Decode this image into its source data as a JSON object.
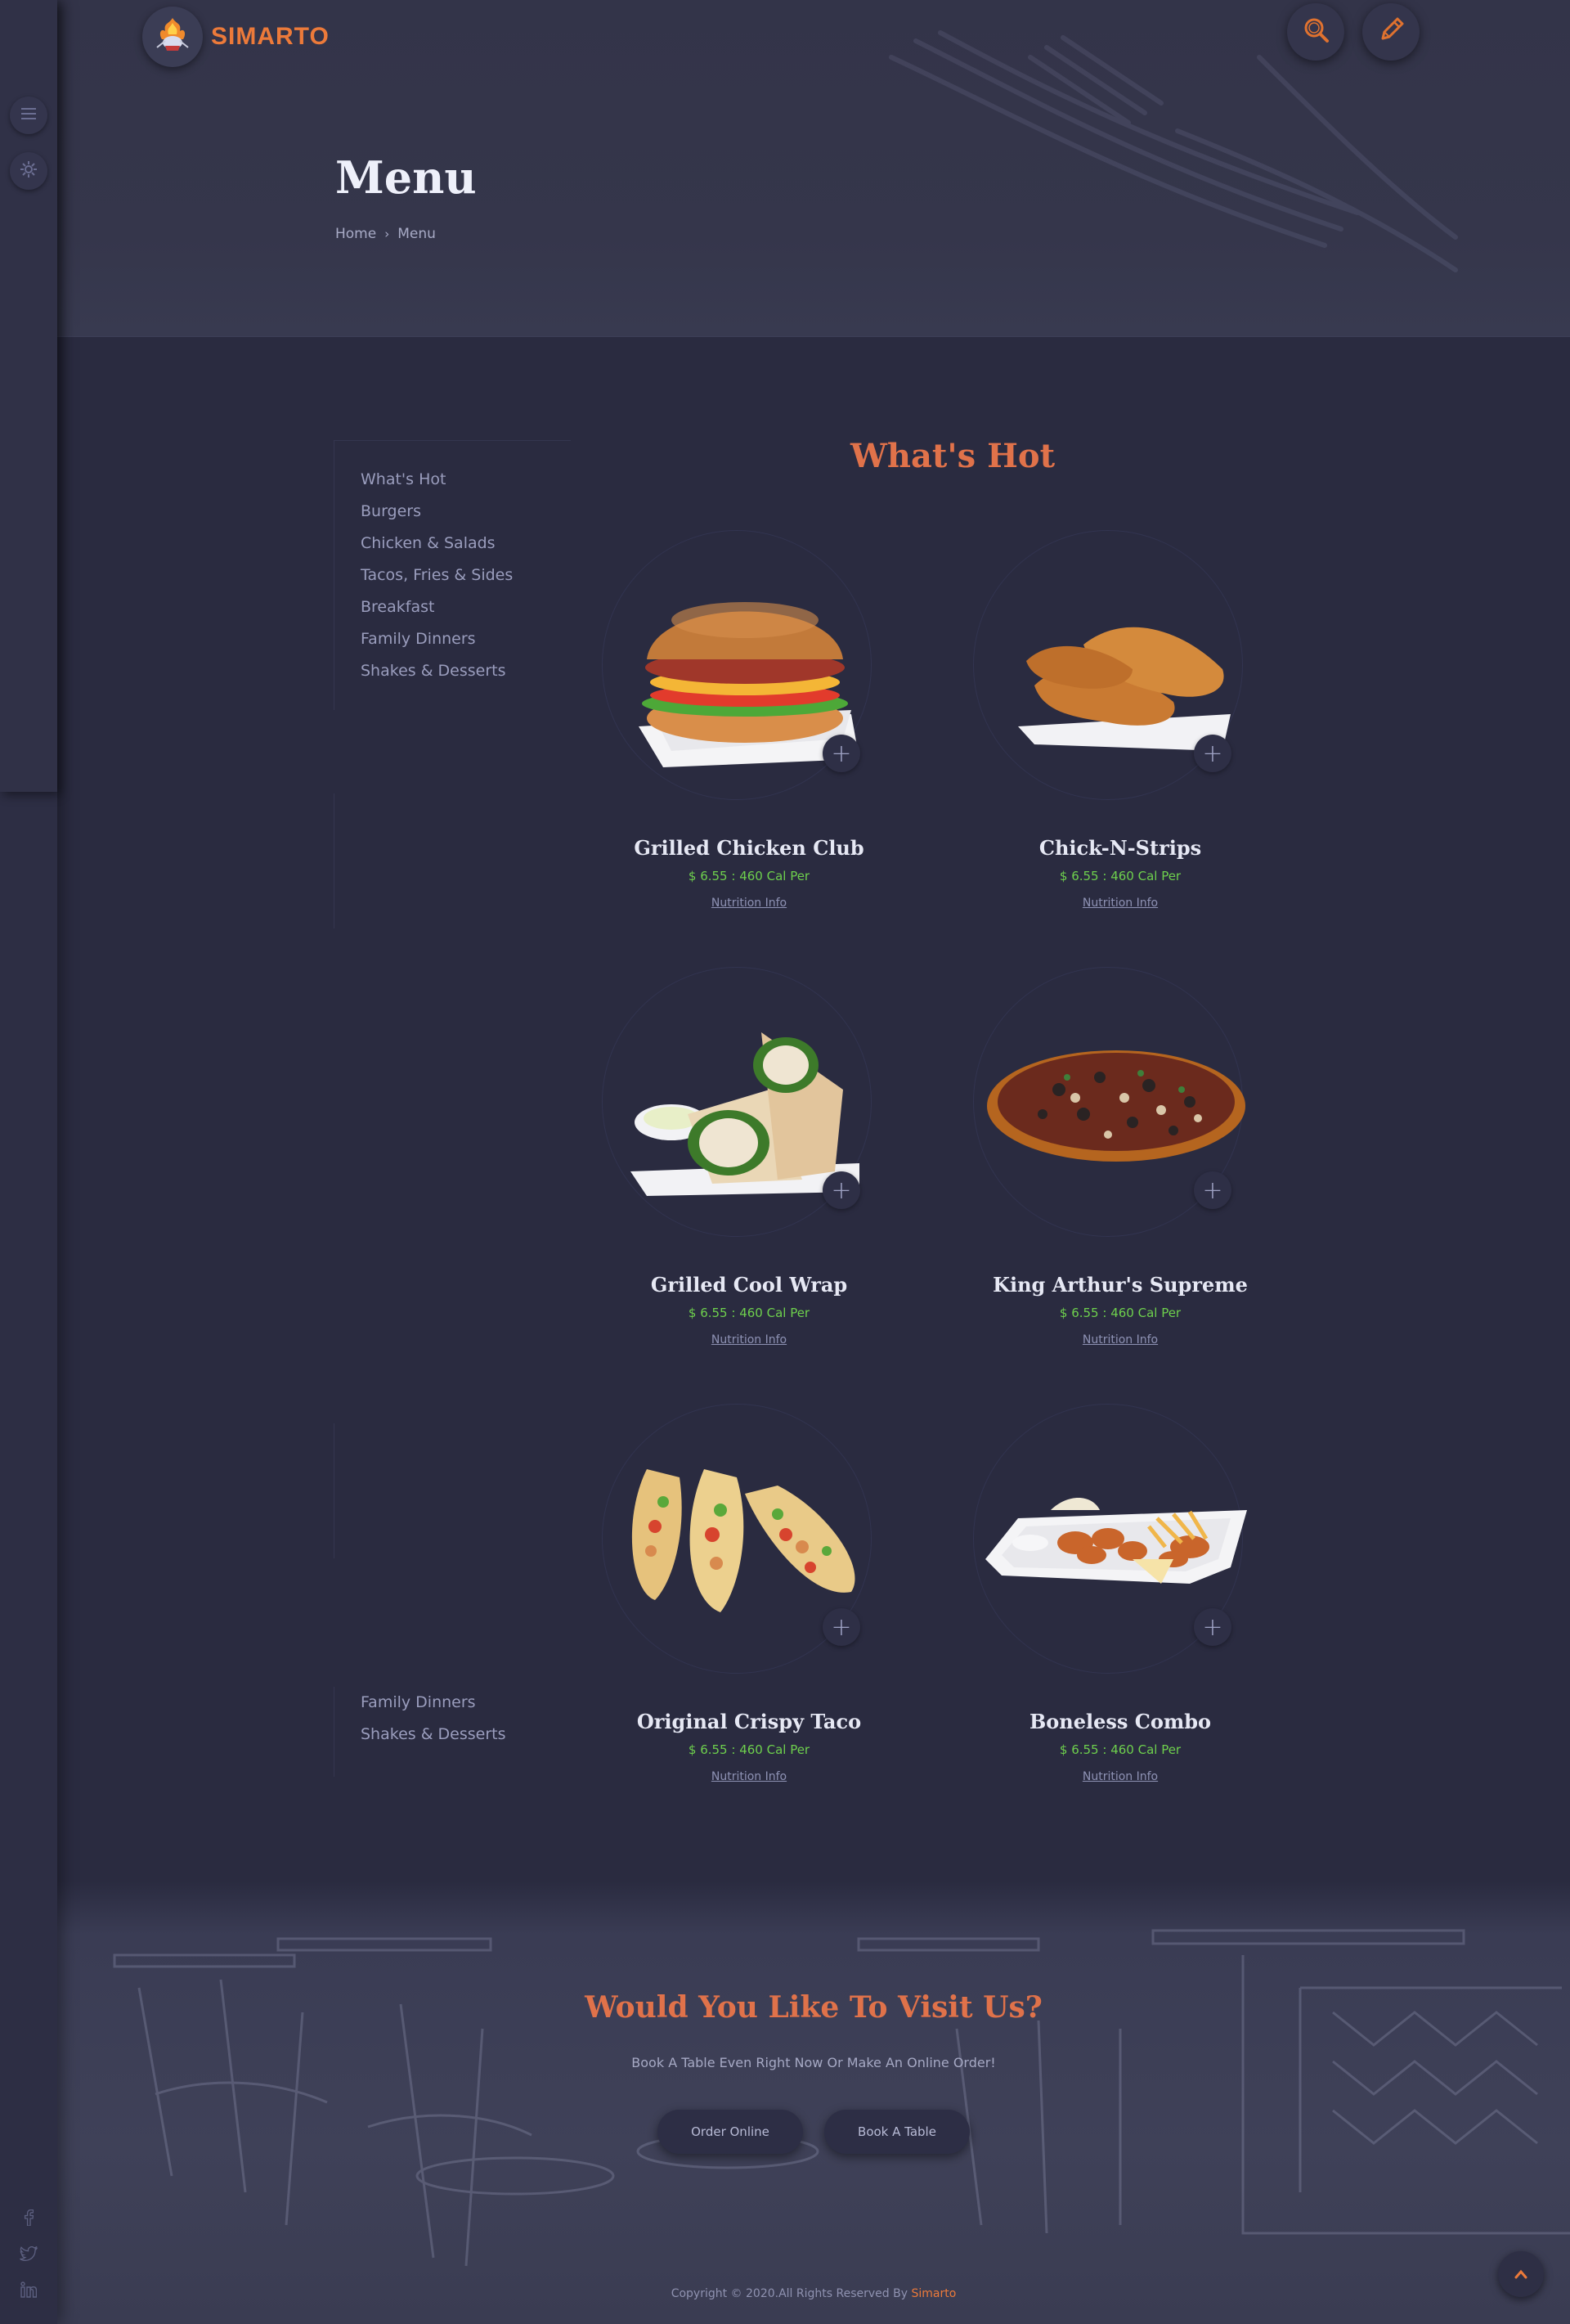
{
  "brand": {
    "name": "SIMARTO",
    "logo_icon": "chef-flame-logo"
  },
  "header": {
    "title": "Menu",
    "breadcrumb": {
      "home": "Home",
      "current": "Menu"
    },
    "search_icon": "search-icon",
    "edit_icon": "pencil-icon"
  },
  "sidebar": {
    "categories": [
      "What's Hot",
      "Burgers",
      "Chicken & Salads",
      "Tacos, Fries & Sides",
      "Breakfast",
      "Family Dinners",
      "Shakes & Desserts"
    ],
    "categories_repeat": [
      "Family Dinners",
      "Shakes & Desserts"
    ]
  },
  "section": {
    "title": "What's Hot"
  },
  "items": [
    {
      "name": "Grilled Chicken Club",
      "price": "$ 6.55 : 460 Cal Per",
      "link": "Nutrition Info"
    },
    {
      "name": "Chick-N-Strips",
      "price": "$ 6.55 : 460 Cal Per",
      "link": "Nutrition Info"
    },
    {
      "name": "Grilled Cool Wrap",
      "price": "$ 6.55 : 460 Cal Per",
      "link": "Nutrition Info"
    },
    {
      "name": "King Arthur's Supreme",
      "price": "$ 6.55 : 460 Cal Per",
      "link": "Nutrition Info"
    },
    {
      "name": "Original Crispy Taco",
      "price": "$ 6.55 : 460 Cal Per",
      "link": "Nutrition Info"
    },
    {
      "name": "Boneless Combo",
      "price": "$ 6.55 : 460 Cal Per",
      "link": "Nutrition Info"
    }
  ],
  "visit": {
    "title": "Would You Like To Visit Us?",
    "subtitle": "Book A Table Even Right Now Or Make An Online Order!",
    "order_button": "Order Online",
    "book_button": "Book A Table"
  },
  "footer": {
    "copyright": "Copyright © 2020.All Rights Reserved By",
    "brand": "Simarto"
  },
  "colors": {
    "accent": "#ec7a3a",
    "title_accent": "#e0724a",
    "price": "#6ed04d",
    "background": "#2a2b40"
  }
}
